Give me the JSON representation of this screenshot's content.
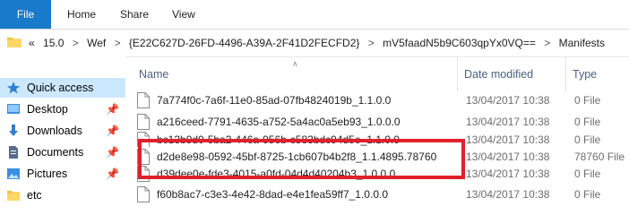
{
  "ribbon": {
    "file": "File",
    "home": "Home",
    "share": "Share",
    "view": "View"
  },
  "address": {
    "overflow": "«",
    "crumbs": [
      "15.0",
      "Wef",
      "{E22C627D-26FD-4496-A39A-2F41D2FECFD2}",
      "mV5faadN5b9C603qpYx0VQ==",
      "Manifests"
    ],
    "separator": ">"
  },
  "nav": {
    "items": [
      {
        "label": "Quick access",
        "icon": "star-icon"
      },
      {
        "label": "Desktop",
        "icon": "desktop-icon",
        "pinned": true
      },
      {
        "label": "Downloads",
        "icon": "download-icon",
        "pinned": true
      },
      {
        "label": "Documents",
        "icon": "documents-icon",
        "pinned": true
      },
      {
        "label": "Pictures",
        "icon": "pictures-icon",
        "pinned": true
      },
      {
        "label": "etc",
        "icon": "folder-icon"
      }
    ]
  },
  "columns": {
    "name": "Name",
    "date": "Date modified",
    "type": "Type"
  },
  "files": [
    {
      "name": "7a774f0c-7a6f-11e0-85ad-07fb4824019b_1.1.0.0",
      "date": "13/04/2017 10:38",
      "type": "0 File"
    },
    {
      "name": "a216ceed-7791-4635-a752-5a4ac0a5eb93_1.0.0.0",
      "date": "13/04/2017 10:38",
      "type": "0 File"
    },
    {
      "name": "bc13b9d0-5ba2-446a-956b-c583bdc94d5e_1.1.0.0",
      "date": "13/04/2017 10:38",
      "type": "0 File"
    },
    {
      "name": "d2de8e98-0592-45bf-8725-1cb607b4b2f8_1.1.4895.78760",
      "date": "13/04/2017 10:38",
      "type": "78760 File"
    },
    {
      "name": "d39dee0e-fde3-4015-a0fd-04d4d40204b3_1.0.0.0",
      "date": "13/04/2017 10:38",
      "type": "0 File"
    },
    {
      "name": "f60b8ac7-c3e3-4e42-8dad-e4e1fea59ff7_1.0.0.0",
      "date": "13/04/2017 10:38",
      "type": "0 File"
    }
  ],
  "colors": {
    "accent": "#1979ca",
    "selection": "#cce8ff",
    "highlight": "#e0202a"
  }
}
